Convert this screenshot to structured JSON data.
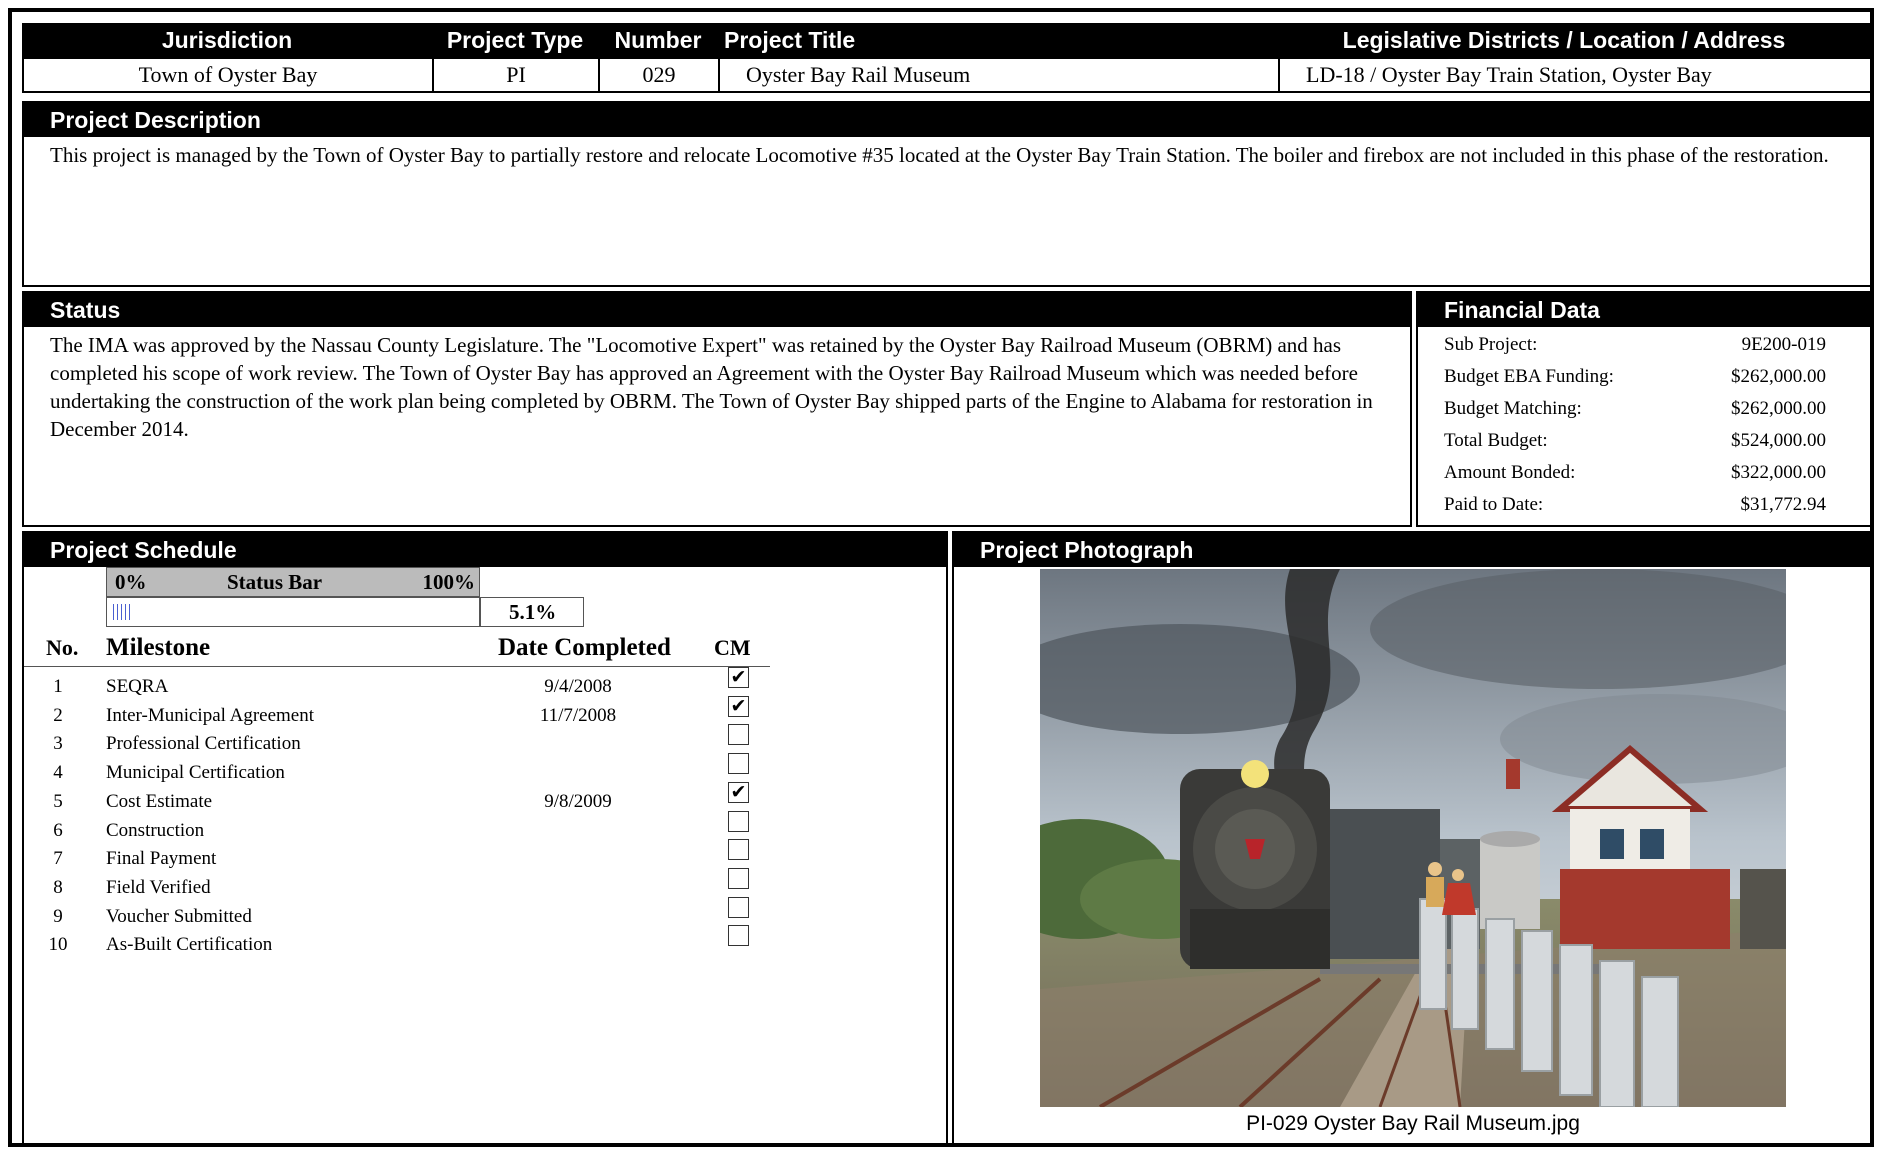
{
  "header": {
    "cols": [
      "Jurisdiction",
      "Project Type",
      "Number",
      "Project Title",
      "Legislative Districts / Location / Address"
    ],
    "values": [
      "Town of Oyster Bay",
      "PI",
      "029",
      "Oyster Bay Rail Museum",
      "LD-18 / Oyster Bay Train Station, Oyster Bay"
    ]
  },
  "description": {
    "title": "Project Description",
    "text": "This project is managed by the Town of Oyster Bay to partially restore and relocate Locomotive #35 located at the Oyster Bay Train Station. The boiler and firebox are not included in this phase of the restoration."
  },
  "status": {
    "title": "Status",
    "text": "The IMA was approved by the Nassau County Legislature. The \"Locomotive Expert\" was retained by the Oyster Bay Railroad Museum (OBRM) and has completed his scope of work review. The Town of Oyster Bay has approved an Agreement with the Oyster Bay Railroad Museum which was needed before undertaking the construction of the work plan being completed by OBRM.  The Town of Oyster Bay shipped parts of the Engine to Alabama for restoration in December 2014."
  },
  "financial": {
    "title": "Financial Data",
    "rows": [
      {
        "label": "Sub Project:",
        "value": "9E200-019"
      },
      {
        "label": "Budget EBA Funding:",
        "value": "$262,000.00"
      },
      {
        "label": "Budget Matching:",
        "value": "$262,000.00"
      },
      {
        "label": "Total Budget:",
        "value": "$524,000.00"
      },
      {
        "label": "Amount Bonded:",
        "value": "$322,000.00"
      },
      {
        "label": "Paid to Date:",
        "value": "$31,772.94"
      }
    ]
  },
  "schedule": {
    "title": "Project Schedule",
    "bar_min": "0%",
    "bar_label": "Status Bar",
    "bar_max": "100%",
    "progress_text": "5.1%",
    "progress": 0.051,
    "col_no": "No.",
    "col_milestone": "Milestone",
    "col_date": "Date Completed",
    "col_cm": "CM",
    "milestones": [
      {
        "no": "1",
        "name": "SEQRA",
        "date": "9/4/2008",
        "checked": true
      },
      {
        "no": "2",
        "name": "Inter-Municipal Agreement",
        "date": "11/7/2008",
        "checked": true
      },
      {
        "no": "3",
        "name": "Professional Certification",
        "date": "",
        "checked": false
      },
      {
        "no": "4",
        "name": "Municipal Certification",
        "date": "",
        "checked": false
      },
      {
        "no": "5",
        "name": "Cost Estimate",
        "date": "9/8/2009",
        "checked": true
      },
      {
        "no": "6",
        "name": "Construction",
        "date": "",
        "checked": false
      },
      {
        "no": "7",
        "name": "Final Payment",
        "date": "",
        "checked": false
      },
      {
        "no": "8",
        "name": "Field Verified",
        "date": "",
        "checked": false
      },
      {
        "no": "9",
        "name": "Voucher Submitted",
        "date": "",
        "checked": false
      },
      {
        "no": "10",
        "name": "As-Built Certification",
        "date": "",
        "checked": false
      }
    ]
  },
  "photo": {
    "title": "Project Photograph",
    "caption": "PI-029 Oyster Bay Rail Museum.jpg"
  }
}
